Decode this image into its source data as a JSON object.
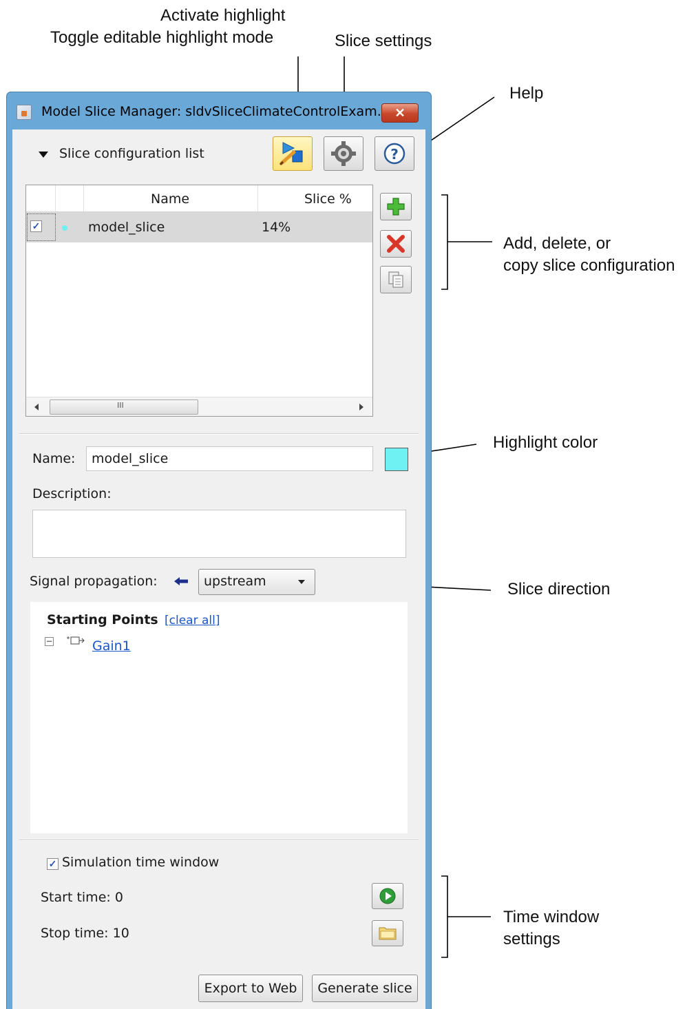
{
  "callouts": {
    "activate_highlight": "Activate highlight",
    "toggle_editable": "Toggle editable highlight mode",
    "slice_settings": "Slice settings",
    "help": "Help",
    "add_delete_copy_1": "Add, delete, or",
    "add_delete_copy_2": "copy slice configuration",
    "highlight_color": "Highlight color",
    "slice_direction": "Slice direction",
    "time_window_1": "Time window",
    "time_window_2": "settings"
  },
  "window": {
    "title": "Model Slice Manager: sldvSliceClimateControlExam...",
    "close_glyph": "✕"
  },
  "config": {
    "section_label": "Slice configuration list",
    "columns": {
      "name": "Name",
      "slice_pct": "Slice %"
    },
    "rows": [
      {
        "checked": true,
        "color": "#6ff0f2",
        "name": "model_slice",
        "slice_pct": "14%"
      }
    ],
    "scroll_mid": "III"
  },
  "form": {
    "name_label": "Name:",
    "name_value": "model_slice",
    "highlight_color": "#6ff0f2",
    "description_label": "Description:",
    "description_value": "",
    "signal_label": "Signal propagation:",
    "direction_value": "upstream"
  },
  "starting_points": {
    "title": "Starting Points",
    "clear_all": "[clear all]",
    "items": [
      {
        "label": "Gain1"
      }
    ]
  },
  "time_window": {
    "checkbox_label": "Simulation time window",
    "checked": true,
    "start_label": "Start time: 0",
    "stop_label": "Stop time: 10"
  },
  "footer": {
    "export_label": "Export to Web",
    "generate_label": "Generate slice"
  },
  "icons": {
    "toolbar": [
      "activate-highlight-icon",
      "slice-settings-gear-icon",
      "help-icon"
    ],
    "side": [
      "add-icon",
      "delete-icon",
      "copy-icon"
    ],
    "time": [
      "play-icon",
      "folder-icon"
    ]
  }
}
